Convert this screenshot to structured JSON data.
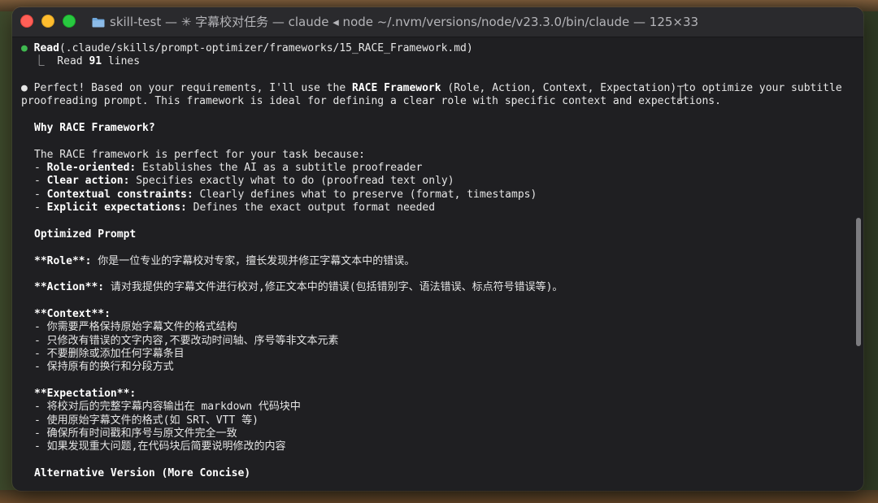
{
  "window": {
    "title": "skill-test — ✳ 字幕校对任务 — claude ◂ node ~/.nvm/versions/node/v23.3.0/bin/claude — 125×33"
  },
  "terminal": {
    "read_tool": "Read",
    "read_arg": "(.claude/skills/prompt-optimizer/frameworks/15_RACE_Framework.md)",
    "read_result_prefix": "⎿  Read ",
    "read_result_count": "91",
    "read_result_suffix": " lines",
    "intro_a": "● Perfect! Based on your requirements, I'll use the ",
    "intro_bold": "RACE Framework",
    "intro_b": " (Role, Action, Context, Expectation) to optimize your subtitle proofreading prompt. This framework is ideal for defining a clear role with specific context and expectations.",
    "why_heading": "Why RACE Framework?",
    "race_perfect": "The RACE framework is perfect for your task because:",
    "bullets": [
      {
        "label": "Role-oriented:",
        "text": " Establishes the AI as a subtitle proofreader"
      },
      {
        "label": "Clear action:",
        "text": " Specifies exactly what to do (proofread text only)"
      },
      {
        "label": "Contextual constraints:",
        "text": " Clearly defines what to preserve (format, timestamps)"
      },
      {
        "label": "Explicit expectations:",
        "text": " Defines the exact output format needed"
      }
    ],
    "optimized_heading": "Optimized Prompt",
    "role_label": "**Role**:",
    "role_text": " 你是一位专业的字幕校对专家，擅长发现并修正字幕文本中的错误。",
    "action_label": "**Action**:",
    "action_text": " 请对我提供的字幕文件进行校对,修正文本中的错误(包括错别字、语法错误、标点符号错误等)。",
    "context_label": "**Context**:",
    "context_items": [
      "- 你需要严格保持原始字幕文件的格式结构",
      "- 只修改有错误的文字内容,不要改动时间轴、序号等非文本元素",
      "- 不要删除或添加任何字幕条目",
      "- 保持原有的换行和分段方式"
    ],
    "expectation_label": "**Expectation**:",
    "expectation_items": [
      "- 将校对后的完整字幕内容输出在 markdown 代码块中",
      "- 使用原始字幕文件的格式(如 SRT、VTT 等)",
      "- 确保所有时间戳和序号与原文件完全一致",
      "- 如果发现重大问题,在代码块后简要说明修改的内容"
    ],
    "alt_heading": "Alternative Version (More Concise)"
  },
  "colors": {
    "terminal_bg": "#1f1f22",
    "text": "#e6e6e6",
    "tool_dot": "#3fb950"
  }
}
